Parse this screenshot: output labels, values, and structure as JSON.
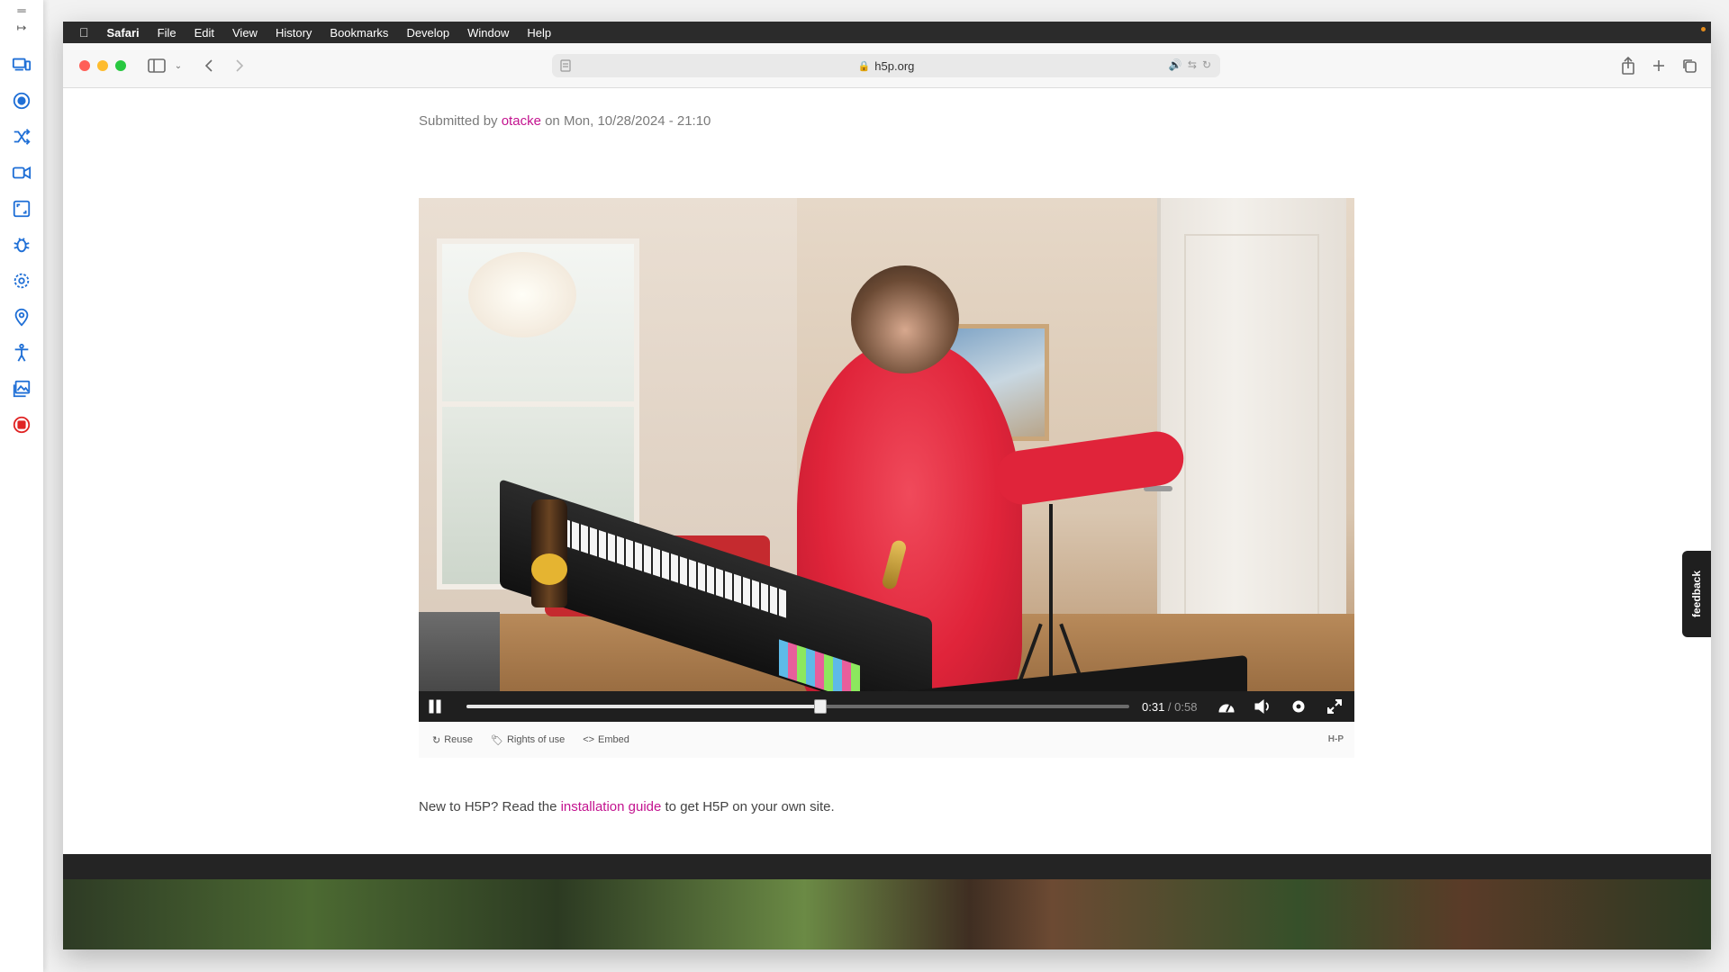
{
  "rail": {
    "top_icons": [
      "menu-icon",
      "collapse-arrow-icon"
    ],
    "tools": [
      {
        "name": "devices-icon"
      },
      {
        "name": "target-icon"
      },
      {
        "name": "shuffle-icon"
      },
      {
        "name": "video-camera-icon"
      },
      {
        "name": "screen-crop-icon"
      },
      {
        "name": "bug-icon"
      },
      {
        "name": "settings-gear-icon"
      },
      {
        "name": "location-pin-icon"
      },
      {
        "name": "accessibility-icon"
      },
      {
        "name": "gallery-icon"
      },
      {
        "name": "record-stop-icon"
      }
    ],
    "accent": "#1f6fd6",
    "stop_color": "#e02424"
  },
  "menubar": {
    "apple": "",
    "app_name": "Safari",
    "items": [
      "File",
      "Edit",
      "View",
      "History",
      "Bookmarks",
      "Develop",
      "Window",
      "Help"
    ]
  },
  "address": {
    "domain": "h5p.org"
  },
  "page": {
    "submitted_prefix": "Submitted by",
    "author": "otacke",
    "submitted_suffix": "on Mon, 10/28/2024 - 21:10",
    "link_color": "#c3138f",
    "intro_prefix": "New to H5P? Read the",
    "intro_link": "installation guide",
    "intro_suffix": "to get H5P on your own site."
  },
  "player": {
    "time_current": "0:31",
    "time_separator": " / ",
    "time_total": "0:58",
    "progress": 0.534,
    "actions": {
      "reuse": "Reuse",
      "rights": "Rights of use",
      "embed": "Embed"
    },
    "logo": "H-P"
  },
  "feedback": {
    "label": "feedback"
  }
}
